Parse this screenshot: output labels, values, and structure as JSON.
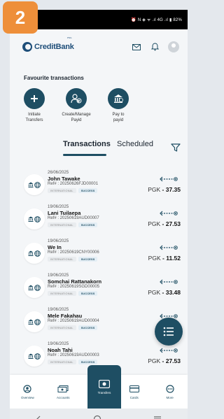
{
  "step_badge": "2",
  "status": {
    "text": "⏰ N ◈ ᯤ .ıl 4G .ıl ▮ 82%"
  },
  "brand": {
    "name": "CreditBank",
    "sub": "PNG"
  },
  "favourites": {
    "title": "Favourite transactions",
    "items": [
      {
        "label_line1": "Initiate",
        "label_line2": "Transfers",
        "icon": "plus-icon"
      },
      {
        "label_line1": "Create/Manage",
        "label_line2": "Payid",
        "icon": "add-user-icon"
      },
      {
        "label_line1": "Pay to",
        "label_line2": "payid",
        "icon": "bank-icon"
      }
    ]
  },
  "tabs": {
    "transactions": "Transactions",
    "scheduled": "Scheduled"
  },
  "transactions": [
    {
      "date": "26/06/2025",
      "name": "John Tawake",
      "ref": "Ref# : 20250626FJD00001",
      "type": "INTERNATIONAL",
      "status": "SUCCESS",
      "currency": "PGK",
      "amount": "- 37.35"
    },
    {
      "date": "19/06/2025",
      "name": "Lani Tuilaepa",
      "ref": "Ref# : 20250619AUD00007",
      "type": "INTERNATIONAL",
      "status": "SUCCESS",
      "currency": "PGK",
      "amount": "- 27.53"
    },
    {
      "date": "19/06/2025",
      "name": "We In",
      "ref": "Ref# : 20250619CNY00006",
      "type": "INTERNATIONAL",
      "status": "SUCCESS",
      "currency": "PGK",
      "amount": "- 11.52"
    },
    {
      "date": "19/06/2025",
      "name": "Somchai Rattanakorn",
      "ref": "Ref# : 20250619SGD00005",
      "type": "INTERNATIONAL",
      "status": "SUCCESS",
      "currency": "PGK",
      "amount": "- 33.48"
    },
    {
      "date": "19/06/2025",
      "name": "Mele Fakahau",
      "ref": "Ref# : 20250619AUD00004",
      "type": "INTERNATIONAL",
      "status": "SUCCESS",
      "currency": "PGK",
      "amount": ""
    },
    {
      "date": "19/06/2025",
      "name": "Noah Tahi",
      "ref": "Ref# : 20250619AUD00003",
      "type": "INTERNATIONAL",
      "status": "SUCCESS",
      "currency": "PGK",
      "amount": "- 27.53"
    }
  ],
  "nav": {
    "overview": "Overview",
    "accounts": "Accounts",
    "transfers": "Transfers",
    "cards": "Cards",
    "more": "More"
  },
  "colors": {
    "primary": "#1e4e63",
    "brand": "#1e4e79",
    "badge": "#ee8f3a"
  }
}
